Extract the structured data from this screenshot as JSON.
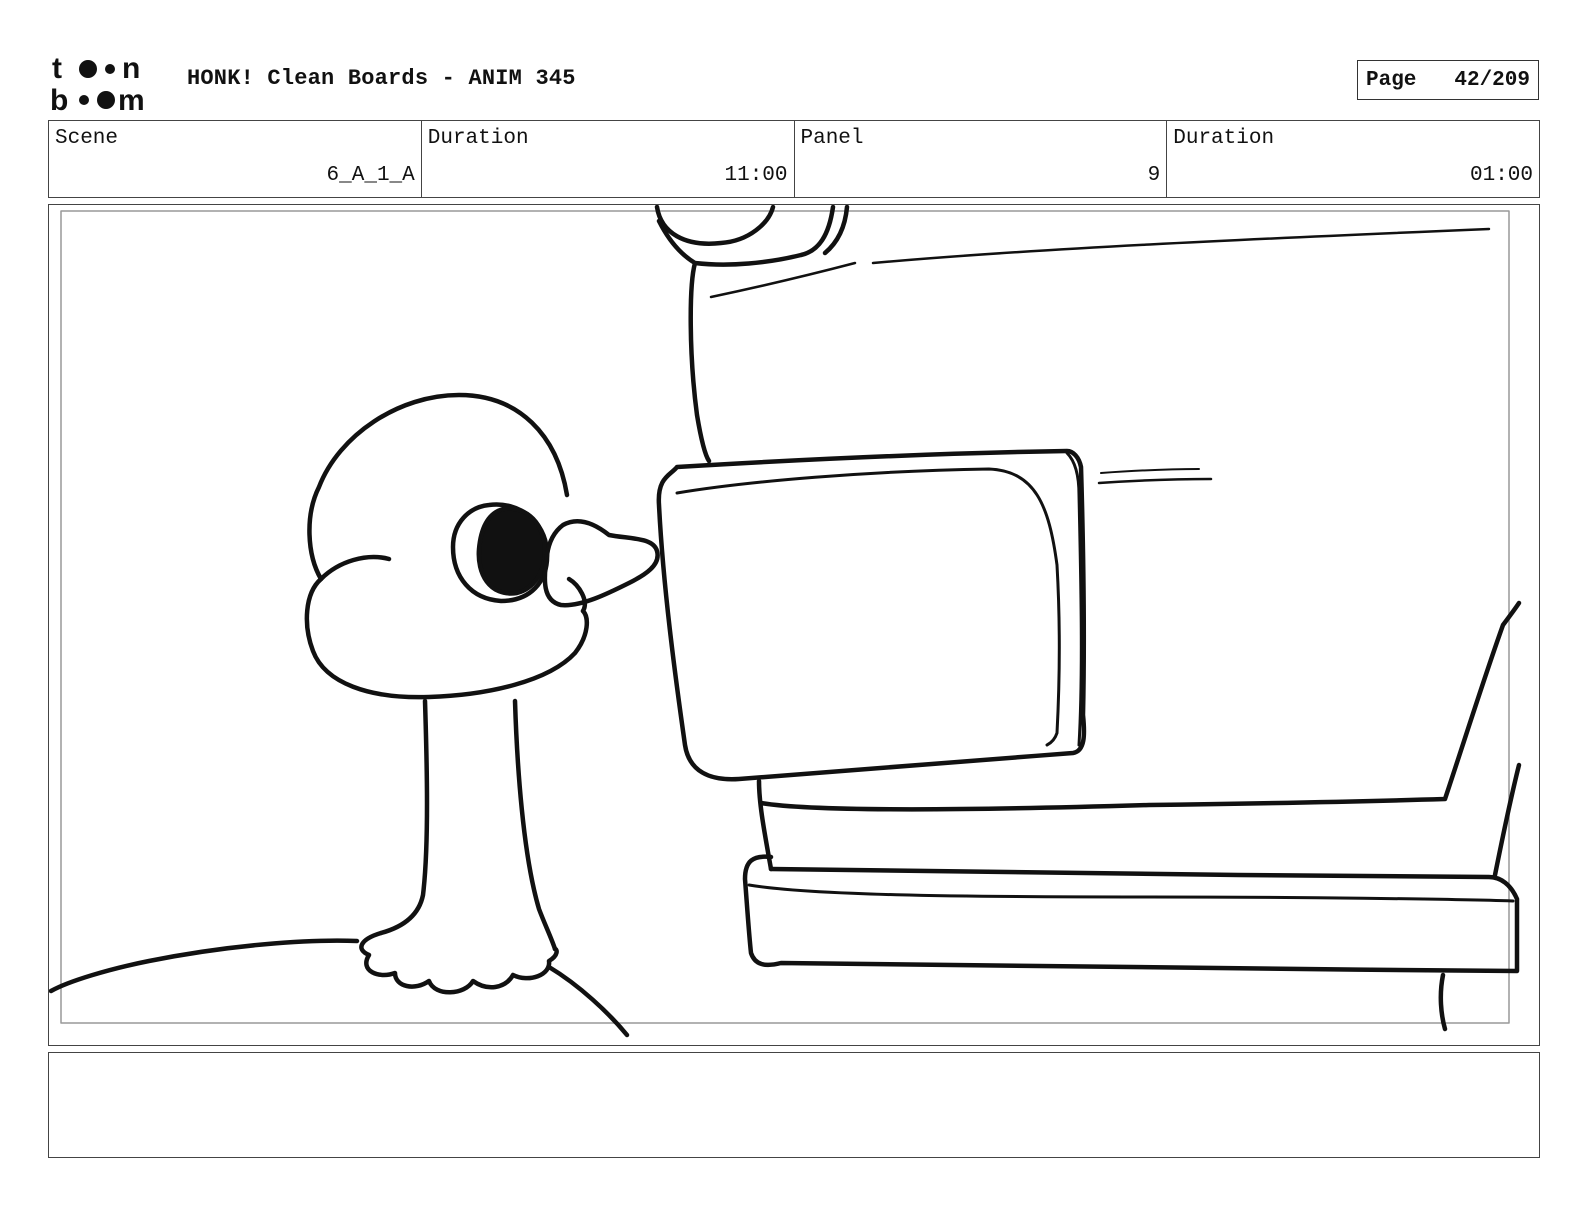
{
  "header": {
    "logo_text_top": "toon",
    "logo_text_bottom": "boom",
    "title": "HONK! Clean Boards - ANIM 345",
    "page_label": "Page",
    "page_value": "42/209"
  },
  "info": {
    "scene_label": "Scene",
    "scene_value": "6_A_1_A",
    "scene_duration_label": "Duration",
    "scene_duration_value": "11:00",
    "panel_label": "Panel",
    "panel_value": "9",
    "panel_duration_label": "Duration",
    "panel_duration_value": "01:00"
  },
  "panel": {
    "drawing": "goose-drawing"
  },
  "notes": {
    "text": ""
  }
}
